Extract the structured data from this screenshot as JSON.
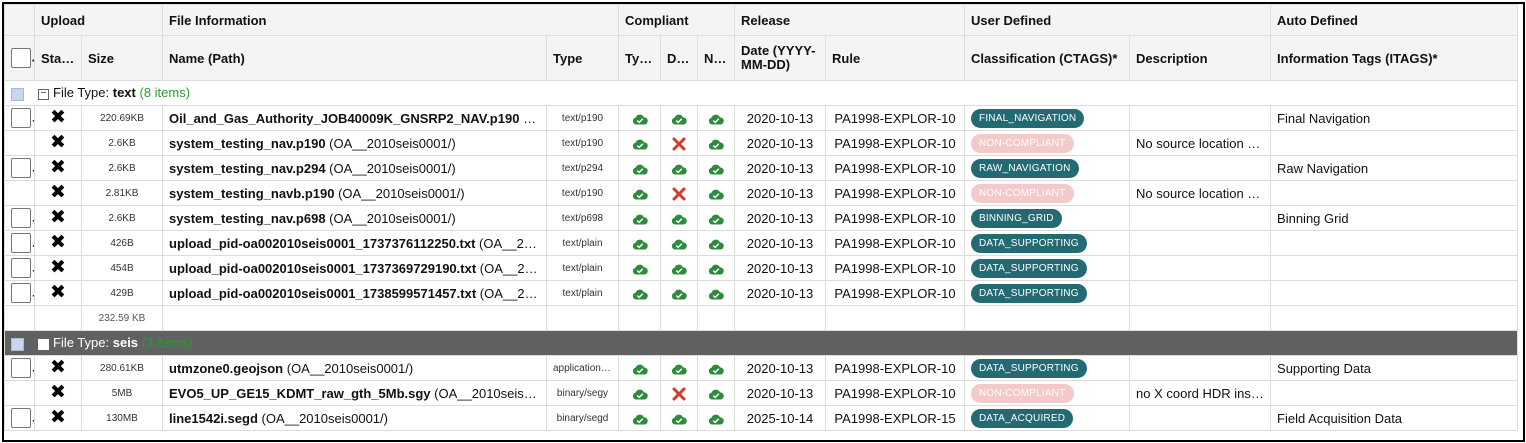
{
  "columns": {
    "group_upload": "Upload",
    "group_file_info": "File Information",
    "group_compliant": "Compliant",
    "group_release": "Release",
    "group_user_defined": "User Defined",
    "group_auto_defined": "Auto Defined",
    "status": "Status",
    "size": "Size",
    "name_path": "Name (Path)",
    "type": "Type",
    "compliant_type": "Type",
    "compliant_data": "Data",
    "compliant_name": "Name",
    "date": "Date (YYYY-MM-DD)",
    "rule": "Rule",
    "classification": "Classification (CTAGS)*",
    "description": "Description",
    "info_tags": "Information Tags (ITAGS)*"
  },
  "groups": [
    {
      "prefix": "File Type: ",
      "name": "text",
      "count": "(8 items)",
      "total_size": "232.59 KB",
      "rows": [
        {
          "size": "220.69KB",
          "name": "Oil_and_Gas_Authority_JOB40009K_GNSRP2_NAV.p190",
          "path": " (…",
          "type": "text/p190",
          "c_type": "ok",
          "c_data": "ok",
          "c_name": "ok",
          "date": "2020-10-13",
          "rule": "PA1998-EXPLOR-10",
          "ctag": "FINAL_NAVIGATION",
          "ctag_style": "ok",
          "description": "",
          "itag": "Final Navigation",
          "checkbox": true
        },
        {
          "size": "2.6KB",
          "name": "system_testing_nav.p190",
          "path": " (OA__2010seis0001/)",
          "type": "text/p190",
          "c_type": "ok",
          "c_data": "bad",
          "c_name": "ok",
          "date": "2020-10-13",
          "rule": "PA1998-EXPLOR-10",
          "ctag": "NON-COMPLIANT",
          "ctag_style": "nc",
          "description": "No source location d…",
          "itag": "",
          "checkbox": false
        },
        {
          "size": "2.6KB",
          "name": "system_testing_nav.p294",
          "path": " (OA__2010seis0001/)",
          "type": "text/p294",
          "c_type": "ok",
          "c_data": "ok",
          "c_name": "ok",
          "date": "2020-10-13",
          "rule": "PA1998-EXPLOR-10",
          "ctag": "RAW_NAVIGATION",
          "ctag_style": "ok",
          "description": "",
          "itag": "Raw Navigation",
          "checkbox": true
        },
        {
          "size": "2.81KB",
          "name": "system_testing_navb.p190",
          "path": " (OA__2010seis0001/)",
          "type": "text/p190",
          "c_type": "ok",
          "c_data": "bad",
          "c_name": "ok",
          "date": "2020-10-13",
          "rule": "PA1998-EXPLOR-10",
          "ctag": "NON-COMPLIANT",
          "ctag_style": "nc",
          "description": "No source location d…",
          "itag": "",
          "checkbox": false
        },
        {
          "size": "2.6KB",
          "name": "system_testing_nav.p698",
          "path": " (OA__2010seis0001/)",
          "type": "text/p698",
          "c_type": "ok",
          "c_data": "ok",
          "c_name": "ok",
          "date": "2020-10-13",
          "rule": "PA1998-EXPLOR-10",
          "ctag": "BINNING_GRID",
          "ctag_style": "ok",
          "description": "",
          "itag": "Binning Grid",
          "checkbox": true
        },
        {
          "size": "426B",
          "name": "upload_pid-oa002010seis0001_1737376112250.txt",
          "path": " (OA__2…",
          "type": "text/plain",
          "c_type": "ok",
          "c_data": "ok",
          "c_name": "ok",
          "date": "2020-10-13",
          "rule": "PA1998-EXPLOR-10",
          "ctag": "DATA_SUPPORTING",
          "ctag_style": "ok",
          "description": "",
          "itag": "",
          "checkbox": true
        },
        {
          "size": "454B",
          "name": "upload_pid-oa002010seis0001_1737369729190.txt",
          "path": " (OA__2…",
          "type": "text/plain",
          "c_type": "ok",
          "c_data": "ok",
          "c_name": "ok",
          "date": "2020-10-13",
          "rule": "PA1998-EXPLOR-10",
          "ctag": "DATA_SUPPORTING",
          "ctag_style": "ok",
          "description": "",
          "itag": "",
          "checkbox": true
        },
        {
          "size": "429B",
          "name": "upload_pid-oa002010seis0001_1738599571457.txt",
          "path": " (OA__2…",
          "type": "text/plain",
          "c_type": "ok",
          "c_data": "ok",
          "c_name": "ok",
          "date": "2020-10-13",
          "rule": "PA1998-EXPLOR-10",
          "ctag": "DATA_SUPPORTING",
          "ctag_style": "ok",
          "description": "",
          "itag": "",
          "checkbox": true
        }
      ]
    },
    {
      "prefix": "File Type: ",
      "name": "seis",
      "count": "(3 items)",
      "rows": [
        {
          "size": "280.61KB",
          "name": "utmzone0.geojson",
          "path": " (OA__2010seis0001/)",
          "type": "application/…",
          "c_type": "ok",
          "c_data": "ok",
          "c_name": "ok",
          "date": "2020-10-13",
          "rule": "PA1998-EXPLOR-10",
          "ctag": "DATA_SUPPORTING",
          "ctag_style": "ok",
          "description": "",
          "itag": "Supporting Data",
          "checkbox": true
        },
        {
          "size": "5MB",
          "name": "EVO5_UP_GE15_KDMT_raw_gth_5Mb.sgy",
          "path": " (OA__2010seis…",
          "type": "binary/segy",
          "c_type": "ok",
          "c_data": "bad",
          "c_name": "ok",
          "date": "2020-10-13",
          "rule": "PA1998-EXPLOR-10",
          "ctag": "NON-COMPLIANT",
          "ctag_style": "nc",
          "description": "no X coord HDR insi…",
          "itag": "",
          "checkbox": false
        },
        {
          "size": "130MB",
          "name": "line1542i.segd",
          "path": " (OA__2010seis0001/)",
          "type": "binary/segd",
          "c_type": "ok",
          "c_data": "ok",
          "c_name": "ok",
          "date": "2025-10-14",
          "rule": "PA1998-EXPLOR-15",
          "ctag": "DATA_ACQUIRED",
          "ctag_style": "ok",
          "description": "",
          "itag": "Field Acquisition Data",
          "checkbox": true
        }
      ]
    }
  ],
  "colors": {
    "badge_teal": "#246a73",
    "badge_noncompliant": "#f4c9c9",
    "ok_green": "#2e8b3e",
    "bad_red": "#d33a2c",
    "group_count_green": "#2e9a2e",
    "seis_group_bg": "#616161"
  },
  "icons": {
    "status": "close-x-icon",
    "compliant_ok": "cloud-check-icon",
    "compliant_bad": "red-x-icon"
  }
}
